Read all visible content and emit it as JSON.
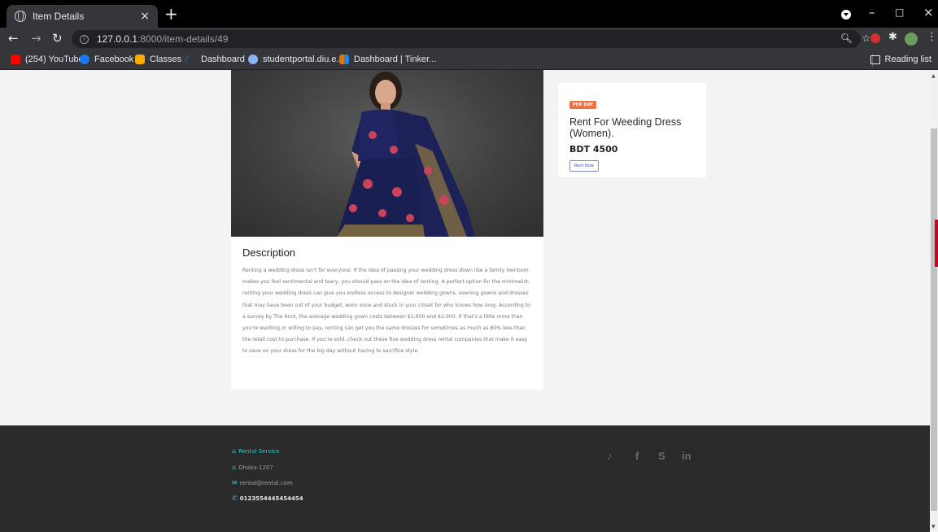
{
  "browser": {
    "tab_title": "Item Details",
    "tab_close": "×",
    "new_tab": "+",
    "url_host": "127.0.0.1",
    "url_path": ":8000/item-details/49",
    "window_controls": [
      "–",
      "□",
      "×"
    ],
    "bookmarks": [
      {
        "label": "(254) YouTube",
        "icon": "youtube-icon",
        "color": "#ff0000"
      },
      {
        "label": "Facebook",
        "icon": "facebook-icon",
        "color": "#1877f2"
      },
      {
        "label": "Classes",
        "icon": "classroom-icon",
        "color": "#f9ab00"
      },
      {
        "label": "Dashboard",
        "icon": "dashboard-icon",
        "color": "#1a73e8"
      },
      {
        "label": "studentportal.diu.e...",
        "icon": "portal-icon",
        "color": "#8ab4f8"
      },
      {
        "label": "Dashboard | Tinker...",
        "icon": "tinkercad-icon",
        "color": "#e37400"
      }
    ],
    "reading_list": "Reading list"
  },
  "item": {
    "badge": "PER DAY",
    "name": "Rent For Weeding Dress (Women).",
    "price": "BDT 4500",
    "rent_button": "Rent Now"
  },
  "description": {
    "heading": "Description",
    "body": "Renting a wedding dress isn't for everyone. If the idea of passing your wedding dress down like a family heirloom makes you feel sentimental and teary, you should pass on the idea of renting. A perfect option for the minimalist, renting your wedding dress can give you endless access to designer wedding gowns, evening gowns and dresses that may have been out of your budget, worn once and stuck in your closet for who knows how long. According to a survey by The Knot, the average wedding gown costs between $1,600 and $2,000. If that's a little more than you're wanting or willing to pay, renting can get you the same dresses for sometimes as much as 80% less than the retail cost to purchase. If you're sold, check out these five wedding dress rental companies that make it easy to save on your dress for the big day without having to sacrifice style."
  },
  "footer": {
    "brand": "Rental Service",
    "address": "Dhaka-1207",
    "email": "rental@rental.com",
    "phone": "0123554445454454",
    "social": [
      "twitter-icon",
      "facebook-icon",
      "skype-icon",
      "linkedin-icon"
    ],
    "social_glyphs": [
      "🐦",
      "f",
      "S",
      "in"
    ]
  },
  "colors": {
    "accent_orange": "#f0703f",
    "footer_bg": "#2a2a2a",
    "footer_accent": "#3ec8c8",
    "saree_blue": "#1c2157"
  }
}
